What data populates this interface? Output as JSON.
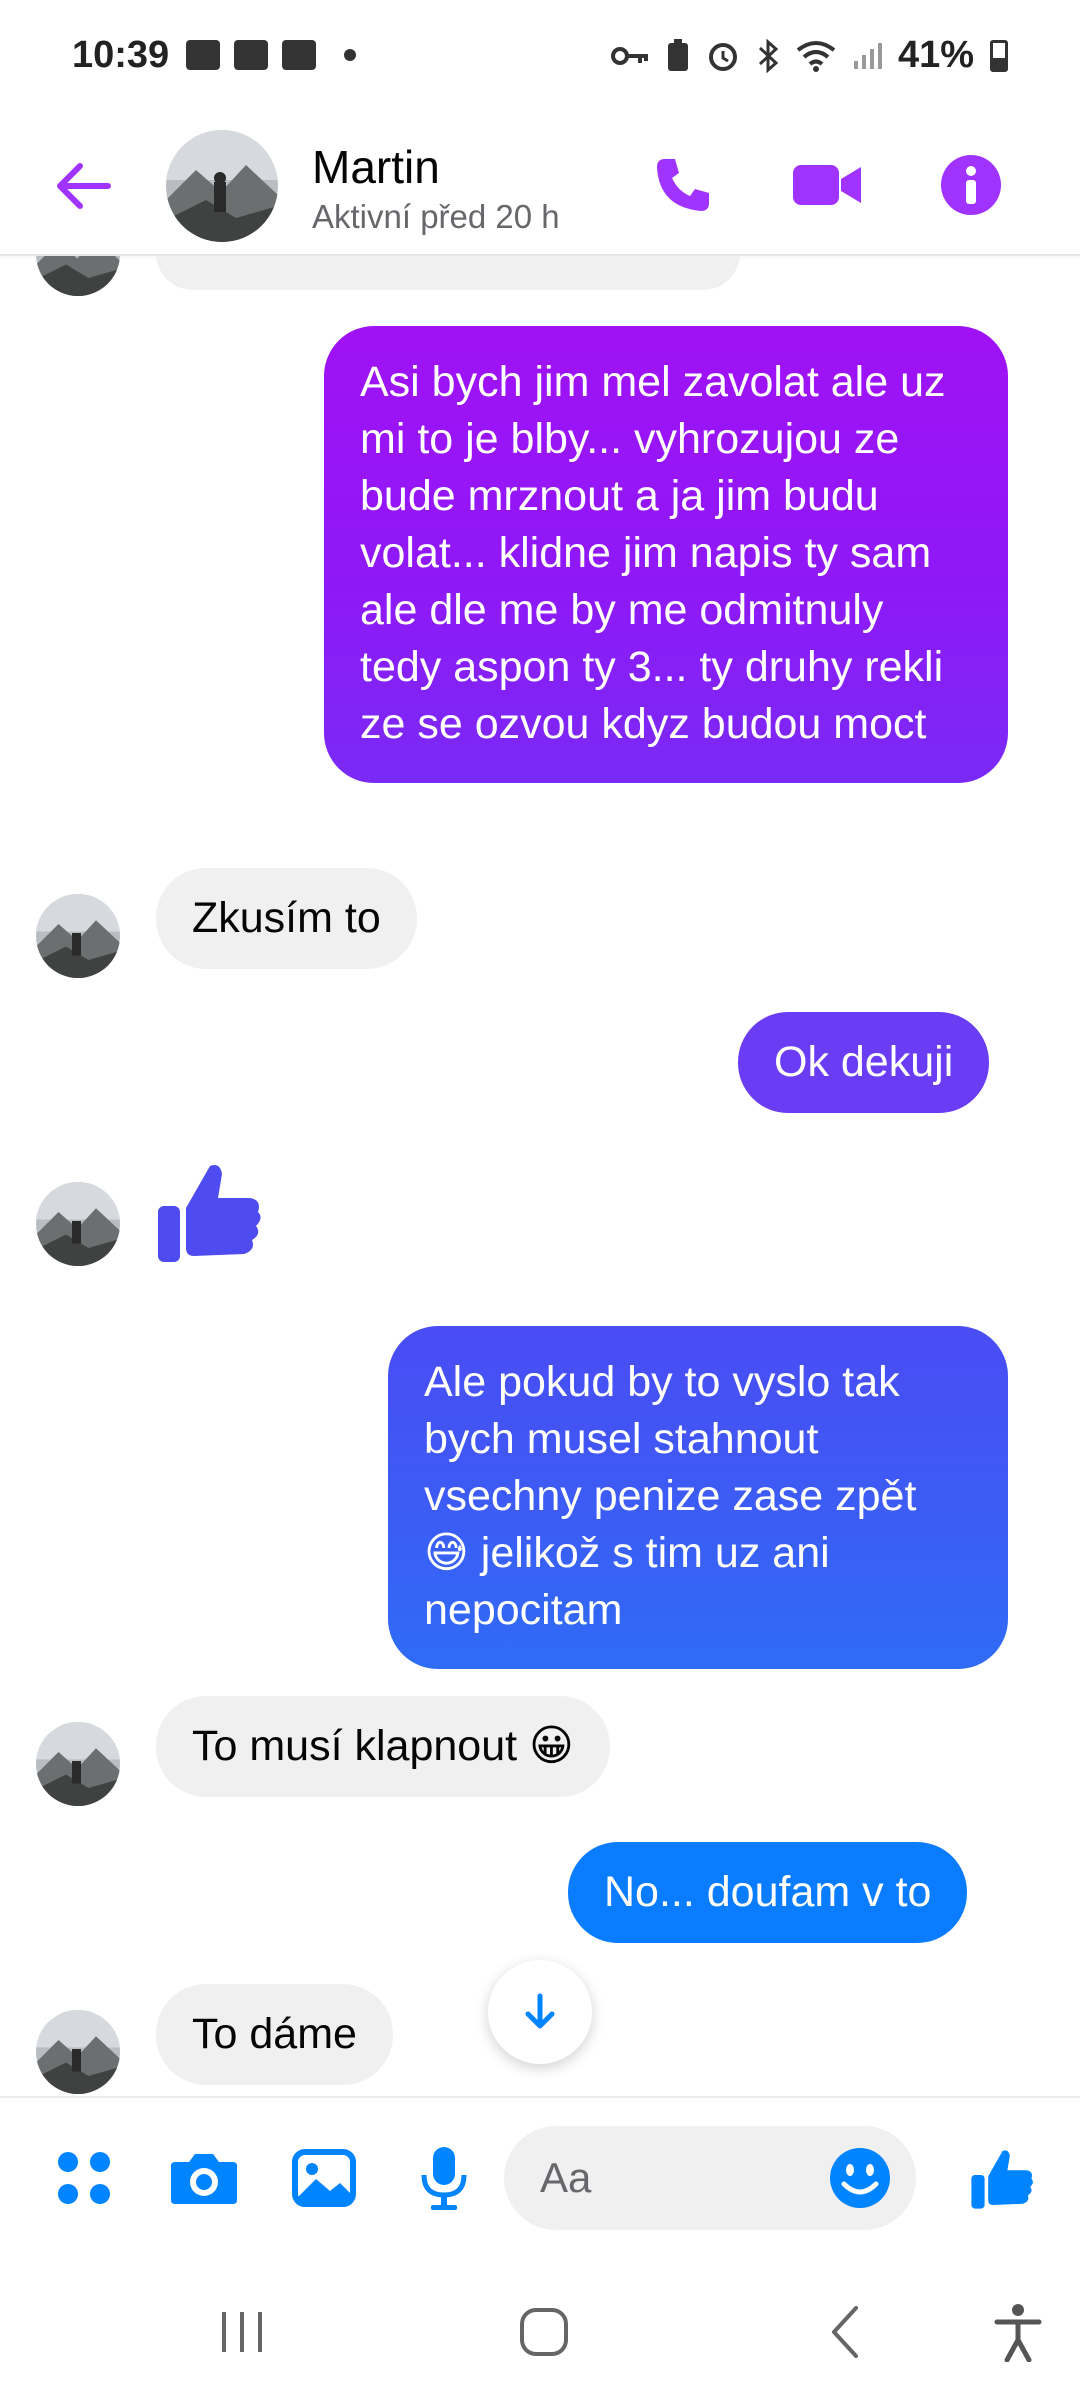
{
  "status_bar": {
    "time": "10:39",
    "battery": "41%",
    "left_icons": [
      "gallery-icon",
      "cast-icon",
      "youtube-icon"
    ],
    "right_icons": [
      "key-icon",
      "battery-saver-icon",
      "alarm-icon",
      "bluetooth-icon",
      "wifi-icon",
      "signal-icon"
    ]
  },
  "header": {
    "contact_name": "Martin",
    "contact_status": "Aktivní před 20 h",
    "icons": [
      "back-arrow-icon",
      "phone-icon",
      "video-camera-icon",
      "info-icon"
    ]
  },
  "colors": {
    "accent": "#0084ff",
    "header_purple": "#a033ff",
    "bubble_purple": "#8f16f6",
    "bubble_indigo": "#5b45f5",
    "bubble_blue": "#2f6cf5",
    "bubble_bright_blue": "#0a7cff",
    "incoming_bg": "#f0f0f0"
  },
  "messages": [
    {
      "type": "in",
      "text": ""
    },
    {
      "type": "out",
      "text": "Asi bych jim mel zavolat ale uz mi to je blby... vyhrozujou ze bude mrznout a ja jim budu volat... klidne jim napis ty sam ale dle me by me odmitnuly tedy aspon ty 3... ty druhy rekli ze se ozvou kdyz budou moct"
    },
    {
      "type": "in",
      "text": "Zkusím to"
    },
    {
      "type": "out",
      "text": "Ok dekuji"
    },
    {
      "type": "in-like",
      "text": "thumbs-up-icon"
    },
    {
      "type": "out",
      "text": "Ale pokud by to vyslo tak bych musel stahnout vsechny penize zase zpět 😅 jelikož s tim uz ani nepocitam"
    },
    {
      "type": "in",
      "text": "To musí klapnout 😀"
    },
    {
      "type": "out",
      "text": "No... doufam v to"
    },
    {
      "type": "in",
      "text": "To dáme"
    }
  ],
  "composer": {
    "placeholder": "Aa",
    "icons": [
      "menu-dots-icon",
      "camera-icon",
      "image-icon",
      "microphone-icon",
      "emoji-icon",
      "thumbs-up-icon"
    ]
  },
  "navbar": {
    "icons": [
      "recents-icon",
      "home-icon",
      "back-icon",
      "accessibility-icon"
    ]
  }
}
